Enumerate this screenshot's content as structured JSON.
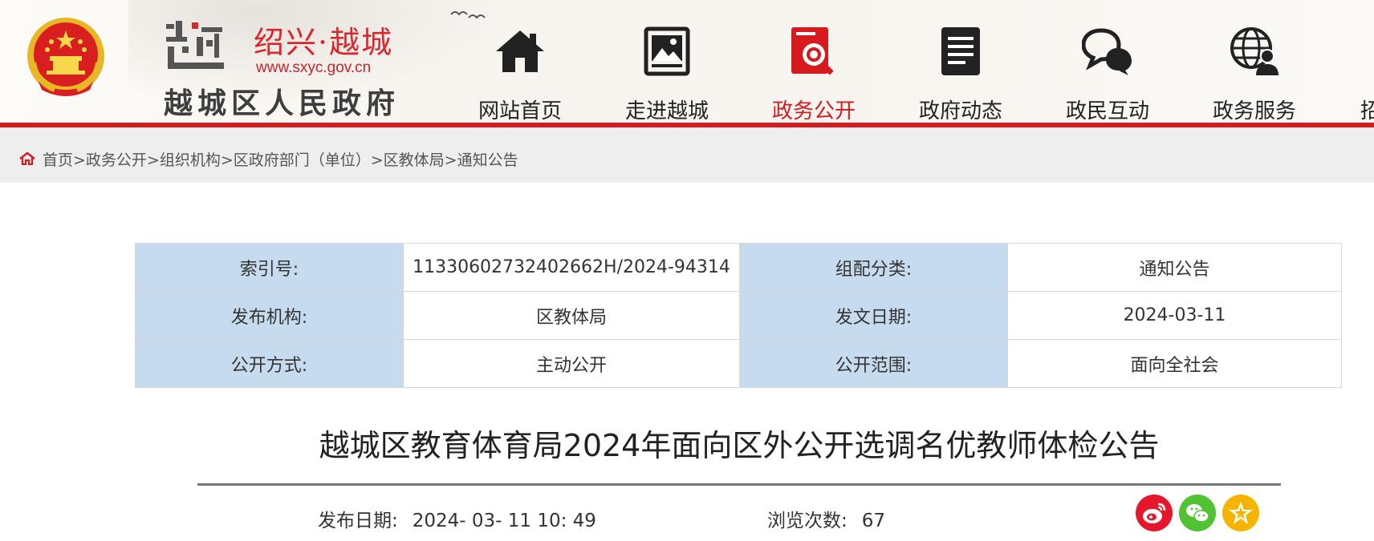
{
  "header": {
    "city": "绍兴·越城",
    "url": "www.sxyc.gov.cn",
    "site_name": "越城区人民政府",
    "logo_glyph": "越"
  },
  "nav": {
    "items": [
      {
        "label": "网站首页",
        "icon": "house-icon"
      },
      {
        "label": "走进越城",
        "icon": "picture-icon"
      },
      {
        "label": "政务公开",
        "icon": "magnifier-document-icon",
        "active": true
      },
      {
        "label": "政府动态",
        "icon": "document-lines-icon"
      },
      {
        "label": "政民互动",
        "icon": "chat-bubbles-icon"
      },
      {
        "label": "政务服务",
        "icon": "globe-person-icon"
      },
      {
        "label": "招"
      }
    ]
  },
  "breadcrumb": {
    "text": "首页>政务公开>组织机构>区政府部门（单位）>区教体局>通知公告"
  },
  "meta": {
    "rows": [
      [
        {
          "label": "索引号:",
          "value": "11330602732402662H/2024-94314"
        },
        {
          "label": "组配分类:",
          "value": "通知公告"
        }
      ],
      [
        {
          "label": "发布机构:",
          "value": "区教体局"
        },
        {
          "label": "发文日期:",
          "value": "2024-03-11"
        }
      ],
      [
        {
          "label": "公开方式:",
          "value": "主动公开"
        },
        {
          "label": "公开范围:",
          "value": "面向全社会"
        }
      ]
    ]
  },
  "article": {
    "title": "越城区教育体育局2024年面向区外公开选调名优教师体检公告",
    "pub_date_label": "发布日期:",
    "pub_date_value": "2024- 03- 11 10: 49",
    "views_label": "浏览次数:",
    "views_value": "67"
  },
  "colors": {
    "brand_red": "#d71a1d",
    "table_label_bg": "#c6dbee",
    "weibo": "#e6162d",
    "wechat": "#51c332",
    "favorite": "#f5b400"
  },
  "share": [
    {
      "name": "weibo-icon"
    },
    {
      "name": "wechat-icon"
    },
    {
      "name": "favorite-star-icon"
    }
  ]
}
